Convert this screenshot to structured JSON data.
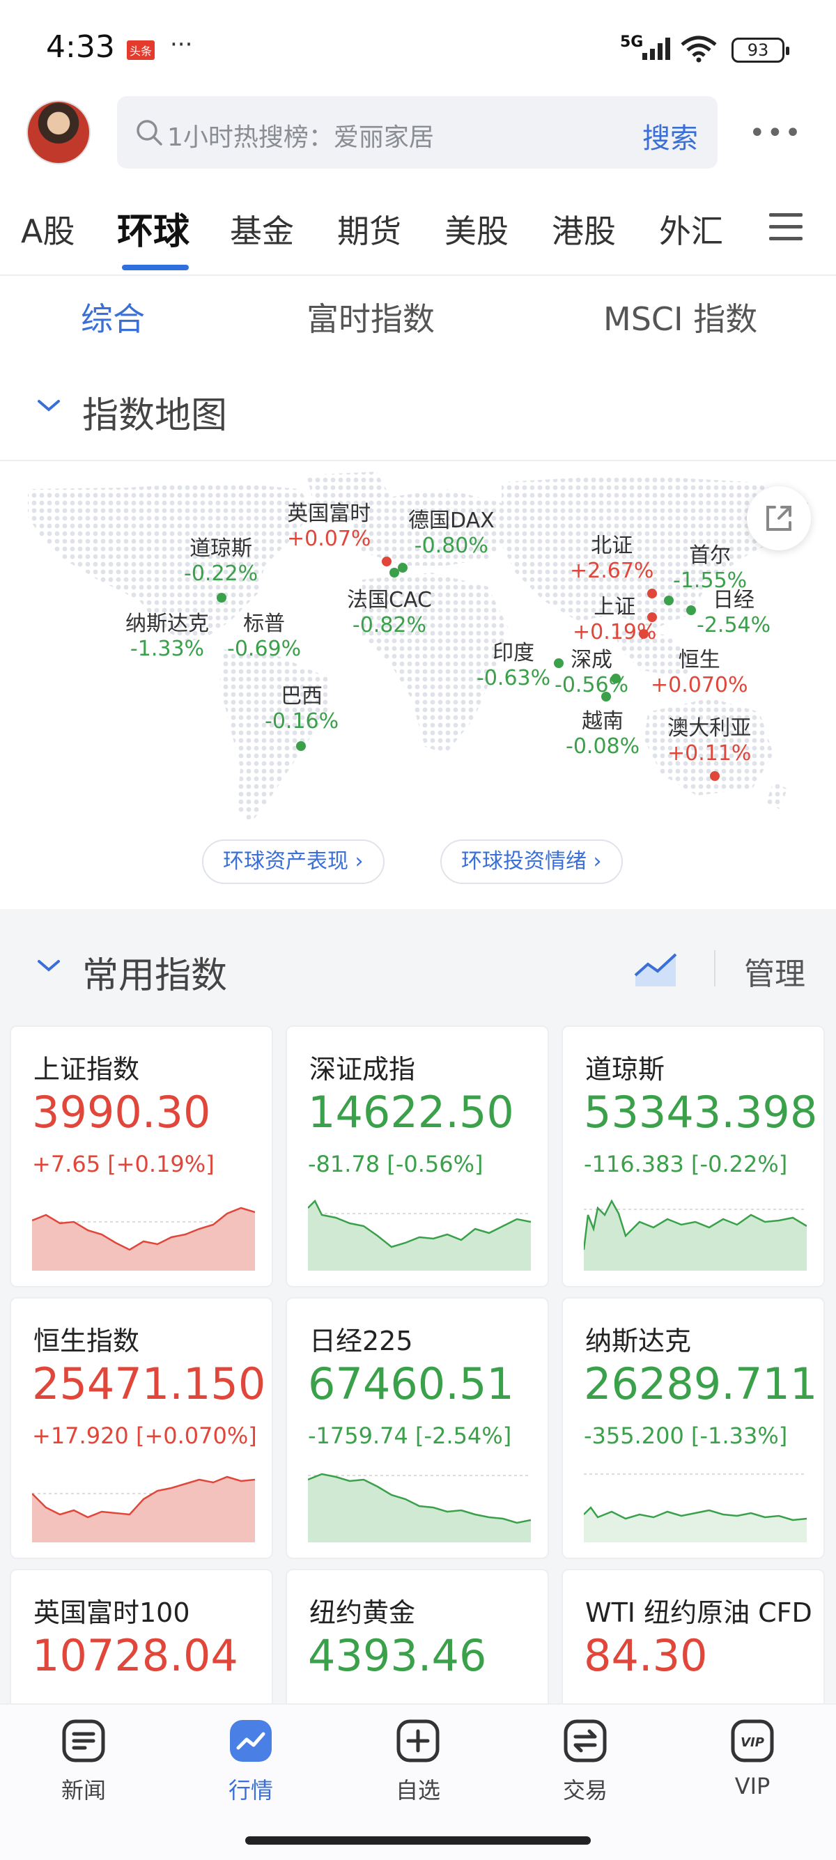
{
  "status_bar": {
    "time": "4:33",
    "app_badge": "头条",
    "network": "5G",
    "battery": "93"
  },
  "search": {
    "placeholder": "1小时热搜榜：爱丽家居",
    "button": "搜索"
  },
  "tabs": [
    {
      "label": "A股"
    },
    {
      "label": "环球",
      "active": true
    },
    {
      "label": "基金"
    },
    {
      "label": "期货"
    },
    {
      "label": "美股"
    },
    {
      "label": "港股"
    },
    {
      "label": "外汇"
    }
  ],
  "sub_tabs": [
    {
      "label": "综合",
      "active": true
    },
    {
      "label": "富时指数"
    },
    {
      "label": "MSCI 指数"
    }
  ],
  "index_map": {
    "title": "指数地图",
    "markers": [
      {
        "name": "英国富时",
        "value": "+0.07%",
        "trend": "up"
      },
      {
        "name": "德国DAX",
        "value": "-0.80%",
        "trend": "down"
      },
      {
        "name": "道琼斯",
        "value": "-0.22%",
        "trend": "down"
      },
      {
        "name": "法国CAC",
        "value": "-0.82%",
        "trend": "down"
      },
      {
        "name": "纳斯达克",
        "value": "-1.33%",
        "trend": "down"
      },
      {
        "name": "标普",
        "value": "-0.69%",
        "trend": "down"
      },
      {
        "name": "巴西",
        "value": "-0.16%",
        "trend": "down"
      },
      {
        "name": "北证",
        "value": "+2.67%",
        "trend": "up"
      },
      {
        "name": "首尔",
        "value": "-1.55%",
        "trend": "down"
      },
      {
        "name": "上证",
        "value": "+0.19%",
        "trend": "up"
      },
      {
        "name": "日经",
        "value": "-2.54%",
        "trend": "down"
      },
      {
        "name": "印度",
        "value": "-0.63%",
        "trend": "down"
      },
      {
        "name": "深成",
        "value": "-0.56%",
        "trend": "down"
      },
      {
        "name": "恒生",
        "value": "+0.070%",
        "trend": "up"
      },
      {
        "name": "越南",
        "value": "-0.08%",
        "trend": "down"
      },
      {
        "name": "澳大利亚",
        "value": "+0.11%",
        "trend": "up"
      }
    ],
    "links": [
      "环球资产表现 ›",
      "环球投资情绪 ›"
    ]
  },
  "common_indices": {
    "title": "常用指数",
    "manage": "管理",
    "cards": [
      {
        "name": "上证指数",
        "price": "3990.30",
        "change": "+7.65 [+0.19%]",
        "trend": "up"
      },
      {
        "name": "深证成指",
        "price": "14622.50",
        "change": "-81.78 [-0.56%]",
        "trend": "down"
      },
      {
        "name": "道琼斯",
        "price": "53343.398",
        "change": "-116.383 [-0.22%]",
        "trend": "down"
      },
      {
        "name": "恒生指数",
        "price": "25471.150",
        "change": "+17.920 [+0.070%]",
        "trend": "up"
      },
      {
        "name": "日经225",
        "price": "67460.51",
        "change": "-1759.74 [-2.54%]",
        "trend": "down"
      },
      {
        "name": "纳斯达克",
        "price": "26289.711",
        "change": "-355.200 [-1.33%]",
        "trend": "down"
      },
      {
        "name": "英国富时100",
        "price": "10728.04",
        "change": "",
        "trend": "up"
      },
      {
        "name": "纽约黄金",
        "price": "4393.46",
        "change": "",
        "trend": "down"
      },
      {
        "name": "WTI 纽约原油 CFD",
        "price": "84.30",
        "change": "",
        "trend": "up"
      }
    ]
  },
  "bottom_nav": [
    {
      "label": "新闻",
      "icon": "news-icon"
    },
    {
      "label": "行情",
      "icon": "market-icon",
      "active": true
    },
    {
      "label": "自选",
      "icon": "add-watchlist-icon"
    },
    {
      "label": "交易",
      "icon": "trade-icon"
    },
    {
      "label": "VIP",
      "icon": "vip-icon"
    }
  ],
  "colors": {
    "up": "#e0463a",
    "down": "#3aa04a",
    "accent": "#3a6fd8"
  }
}
